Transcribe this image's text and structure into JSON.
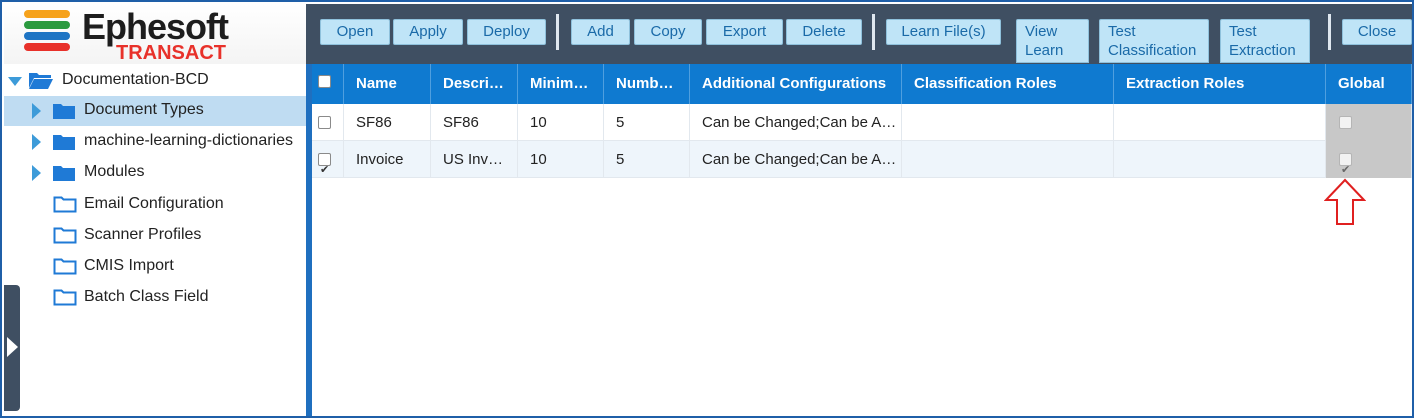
{
  "app": {
    "logo_title": "Ephesoft",
    "logo_subtitle": "TRANSACT"
  },
  "toolbar": {
    "open": "Open",
    "apply": "Apply",
    "deploy": "Deploy",
    "add": "Add",
    "copy": "Copy",
    "export": "Export",
    "delete": "Delete",
    "learn_files": "Learn File(s)",
    "view_learn_1": "View",
    "view_learn_2": "Learn",
    "test_classification_1": "Test",
    "test_classification_2": "Classification",
    "test_extraction_1": "Test",
    "test_extraction_2": "Extraction",
    "close": "Close"
  },
  "tree": {
    "root": "Documentation-BCD",
    "items": [
      {
        "label": "Document Types",
        "type": "folder-filled",
        "expandable": true,
        "selected": true
      },
      {
        "label": "machine-learning-dictionaries",
        "type": "folder-filled",
        "expandable": true,
        "selected": false
      },
      {
        "label": "Modules",
        "type": "folder-filled",
        "expandable": true,
        "selected": false
      },
      {
        "label": "Email Configuration",
        "type": "folder-outline",
        "expandable": false,
        "selected": false
      },
      {
        "label": "Scanner Profiles",
        "type": "folder-outline",
        "expandable": false,
        "selected": false
      },
      {
        "label": "CMIS Import",
        "type": "folder-outline",
        "expandable": false,
        "selected": false
      },
      {
        "label": "Batch Class Field",
        "type": "folder-outline",
        "expandable": false,
        "selected": false
      }
    ]
  },
  "grid": {
    "columns": [
      "Name",
      "Descri…",
      "Minim…",
      "Numb…",
      "Additional Configurations",
      "Classification Roles",
      "Extraction Roles",
      "Global"
    ],
    "rows": [
      {
        "checked": false,
        "name": "SF86",
        "description": "SF86",
        "minimum": "10",
        "number": "5",
        "additional": "Can be Changed;Can be A…",
        "classification_roles": "",
        "extraction_roles": "",
        "global": false
      },
      {
        "checked": true,
        "name": "Invoice",
        "description": "US Inv…",
        "minimum": "10",
        "number": "5",
        "additional": "Can be Changed;Can be A…",
        "classification_roles": "",
        "extraction_roles": "",
        "global": true
      }
    ]
  },
  "colors": {
    "toolbar_bg": "#3f4f62",
    "button_bg": "#bfe4f7",
    "header_bg": "#0f7ad0",
    "selected_row": "#bfdcf2",
    "annotation_arrow": "#e02020"
  }
}
